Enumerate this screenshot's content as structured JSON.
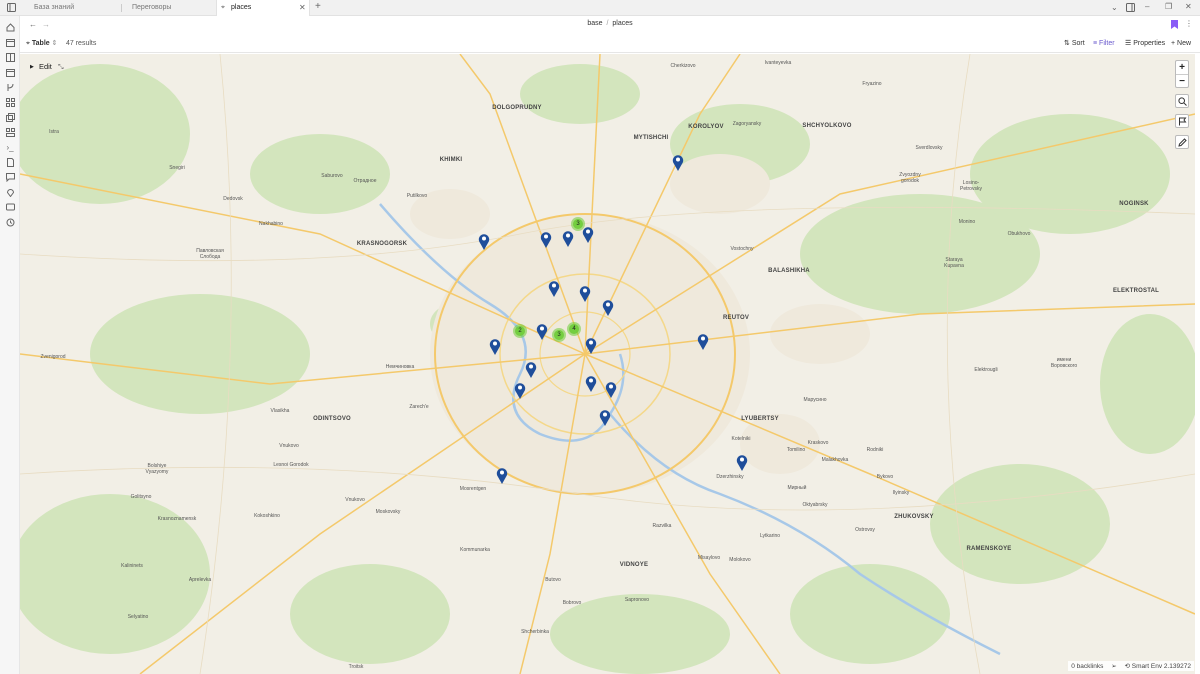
{
  "tabs": [
    {
      "label": "База знаний",
      "active": false
    },
    {
      "label": "Переговоры",
      "active": false
    },
    {
      "label": "places",
      "active": true
    }
  ],
  "breadcrumb": {
    "part1": "base",
    "sep": "/",
    "part2": "places"
  },
  "toolbar": {
    "view_label": "Table",
    "results": "47 results",
    "sort_label": "Sort",
    "filter_label": "Filter",
    "properties_label": "Properties",
    "new_label": "New"
  },
  "map": {
    "edit_label": "Edit",
    "zoom_in": "+",
    "zoom_out": "−",
    "labels": [
      {
        "text": "Cherkizovo",
        "big": false
      },
      {
        "text": "Ivanteyevka",
        "big": false
      },
      {
        "text": "Fryazino",
        "big": false
      },
      {
        "text": "DOLGOPRUDNY",
        "big": true
      },
      {
        "text": "Istra",
        "big": false
      },
      {
        "text": "MYTISHCHI",
        "big": true
      },
      {
        "text": "KOROLYOV",
        "big": true
      },
      {
        "text": "Zagoryansky",
        "big": false
      },
      {
        "text": "SHCHYOLKOVO",
        "big": true
      },
      {
        "text": "Sverdlovsky",
        "big": false
      },
      {
        "text": "KHIMKI",
        "big": true
      },
      {
        "text": "Snegiri",
        "big": false
      },
      {
        "text": "Saburovo",
        "big": false
      },
      {
        "text": "Отрадное",
        "big": false
      },
      {
        "text": "Putilkovo",
        "big": false
      },
      {
        "text": "Zvyozdny gorodok",
        "big": false
      },
      {
        "text": "Losino-Petrovsky",
        "big": false
      },
      {
        "text": "NOGINSK",
        "big": true
      },
      {
        "text": "Dedovsk",
        "big": false
      },
      {
        "text": "Nakhabino",
        "big": false
      },
      {
        "text": "Monino",
        "big": false
      },
      {
        "text": "Obukhovo",
        "big": false
      },
      {
        "text": "KRASNOGORSK",
        "big": true
      },
      {
        "text": "Vostochny",
        "big": false
      },
      {
        "text": "Павловская Слобода",
        "big": false
      },
      {
        "text": "Staraya Kupavna",
        "big": false
      },
      {
        "text": "BALASHIKHA",
        "big": true
      },
      {
        "text": "ELEKTROSTAL",
        "big": true
      },
      {
        "text": "REUTOV",
        "big": true
      },
      {
        "text": "Zvenigorod",
        "big": false
      },
      {
        "text": "Немчиновка",
        "big": false
      },
      {
        "text": "имени Воровского",
        "big": false
      },
      {
        "text": "Elektrougli",
        "big": false
      },
      {
        "text": "Zarech'e",
        "big": false
      },
      {
        "text": "Vlasikha",
        "big": false
      },
      {
        "text": "ODINTSOVO",
        "big": true
      },
      {
        "text": "Марусино",
        "big": false
      },
      {
        "text": "LYUBERTSY",
        "big": true
      },
      {
        "text": "Kotelniki",
        "big": false
      },
      {
        "text": "Kraskovo",
        "big": false
      },
      {
        "text": "Vnukovo",
        "big": false
      },
      {
        "text": "Tomilino",
        "big": false
      },
      {
        "text": "Rodniki",
        "big": false
      },
      {
        "text": "Bolshiye Vyazyomy",
        "big": false
      },
      {
        "text": "Lesnoi Gorodok",
        "big": false
      },
      {
        "text": "Malakhovka",
        "big": false
      },
      {
        "text": "Dzerzhinsky",
        "big": false
      },
      {
        "text": "Bykovo",
        "big": false
      },
      {
        "text": "Mosrentgen",
        "big": false
      },
      {
        "text": "Мирный",
        "big": false
      },
      {
        "text": "Golitsyno",
        "big": false
      },
      {
        "text": "Vnukovo",
        "big": false
      },
      {
        "text": "Moskovsky",
        "big": false
      },
      {
        "text": "Ilyinsky",
        "big": false
      },
      {
        "text": "Oktyabrsky",
        "big": false
      },
      {
        "text": "Kokoshkino",
        "big": false
      },
      {
        "text": "Krasnoznamensk",
        "big": false
      },
      {
        "text": "Razvilka",
        "big": false
      },
      {
        "text": "ZHUKOVSKY",
        "big": true
      },
      {
        "text": "Ostrovsy",
        "big": false
      },
      {
        "text": "Lytkarino",
        "big": false
      },
      {
        "text": "RAMENSKOYE",
        "big": true
      },
      {
        "text": "Kommunarka",
        "big": false
      },
      {
        "text": "VIDNOYE",
        "big": true
      },
      {
        "text": "Kalininets",
        "big": false
      },
      {
        "text": "Misaylovo",
        "big": false
      },
      {
        "text": "Molokovo",
        "big": false
      },
      {
        "text": "Aprelevka",
        "big": false
      },
      {
        "text": "Butovo",
        "big": false
      },
      {
        "text": "Bobrovo",
        "big": false
      },
      {
        "text": "Sapronovo",
        "big": false
      },
      {
        "text": "Selyatino",
        "big": false
      },
      {
        "text": "Shcherbinka",
        "big": false
      },
      {
        "text": "Troitsk",
        "big": false
      }
    ],
    "clusters": [
      "3",
      "2",
      "3",
      "4"
    ]
  },
  "status": {
    "backlinks": "0 backlinks",
    "env": "Smart Env 2.139272"
  },
  "colors": {
    "accent": "#7b5cff",
    "pin": "#1f4e9b",
    "cluster": "#6ecc39",
    "map_bg": "#f2efe6",
    "park": "#cfe3b4",
    "road": "#f7d479"
  },
  "icons": {
    "sidebar": [
      "home-icon",
      "calendar-icon",
      "book-icon",
      "calendar-icon",
      "git-branch-icon",
      "grid-icon",
      "files-icon",
      "layout-icon",
      "terminal-icon",
      "document-icon",
      "chat-icon",
      "map-pin-icon",
      "chat-icon",
      "history-icon"
    ]
  }
}
